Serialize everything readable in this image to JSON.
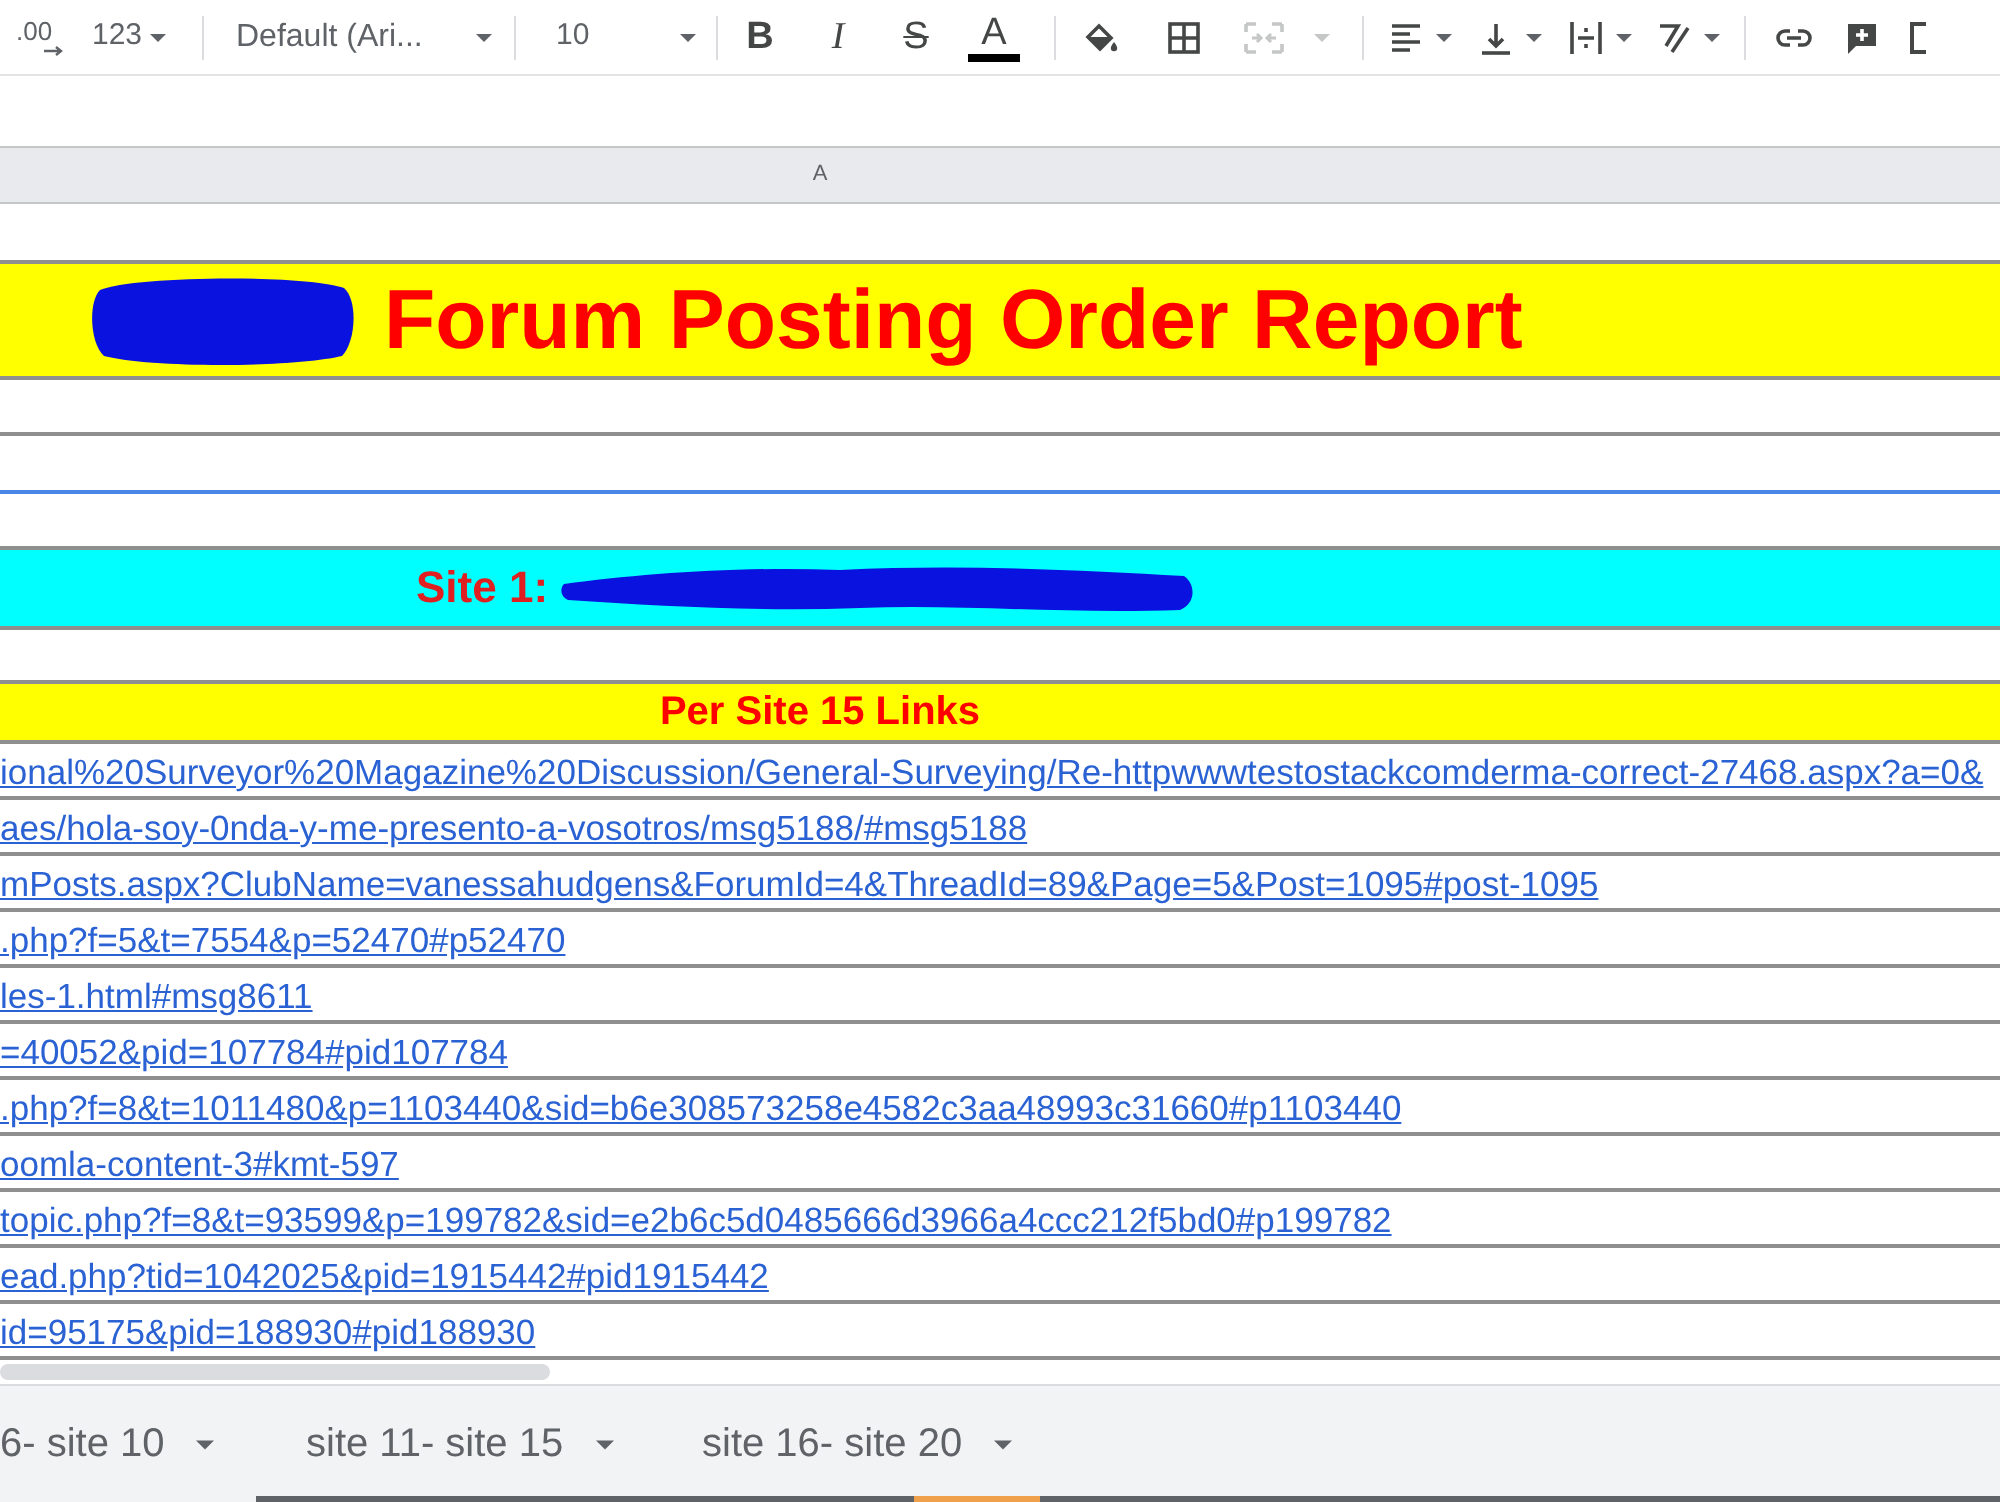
{
  "toolbar": {
    "decimal_label": ".00",
    "number_format": "123",
    "font": "Default (Ari...",
    "font_size": "10",
    "text_styles": [
      {
        "kind": "bold",
        "glyph": "B"
      },
      {
        "kind": "italic",
        "glyph": "I"
      },
      {
        "kind": "strikethrough",
        "glyph": "S"
      },
      {
        "kind": "text_color",
        "glyph": "A"
      }
    ],
    "merge_cells": {
      "disabled": true
    }
  },
  "column_header": {
    "label": "A"
  },
  "sheet": {
    "title": "Forum Posting Order Report",
    "site_label": "Site 1:",
    "links_heading": "Per Site 15 Links",
    "links": [
      "ional%20Surveyor%20Magazine%20Discussion/General-Surveying/Re-httpwwwtestostackcomderma-correct-27468.aspx?a=0&",
      "aes/hola-soy-0nda-y-me-presento-a-vosotros/msg5188/#msg5188",
      "mPosts.aspx?ClubName=vanessahudgens&ForumId=4&ThreadId=89&Page=5&Post=1095#post-1095",
      ".php?f=5&t=7554&p=52470#p52470",
      "les-1.html#msg8611",
      "=40052&pid=107784#pid107784",
      ".php?f=8&t=1011480&p=1103440&sid=b6e308573258e4582c3aa48993c31660#p1103440",
      "oomla-content-3#kmt-597",
      "topic.php?f=8&t=93599&p=199782&sid=e2b6c5d0485666d3966a4ccc212f5bd0#p199782",
      "ead.php?tid=1042025&pid=1915442#pid1915442",
      "id=95175&pid=188930#pid188930"
    ]
  },
  "sheet_tabs": [
    {
      "label": "6- site 10",
      "selected": false
    },
    {
      "label": "site 11- site 15",
      "selected": false
    },
    {
      "label": "site 16- site 20",
      "selected": false,
      "color": "#f0a04b"
    }
  ]
}
